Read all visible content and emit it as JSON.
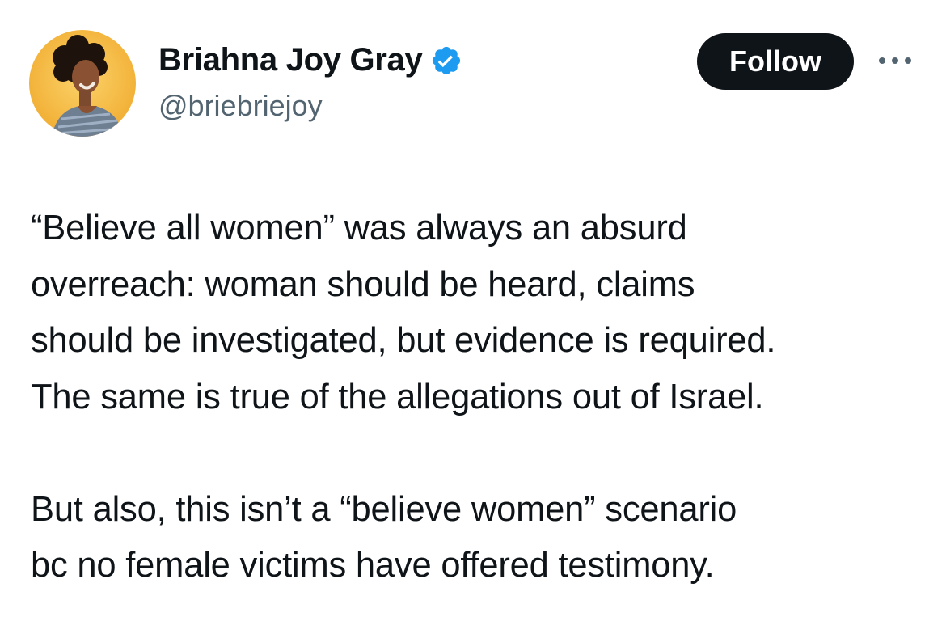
{
  "author": {
    "display_name": "Briahna Joy Gray",
    "handle": "@briebriejoy",
    "verified": true,
    "avatar_background": "#f4b63f"
  },
  "actions": {
    "follow_label": "Follow",
    "more_icon": "more-horizontal-icon"
  },
  "colors": {
    "text_primary": "#0f1419",
    "text_secondary": "#536471",
    "verified_badge": "#1d9bf0",
    "follow_button_bg": "#0f1419"
  },
  "tweet": {
    "paragraphs": [
      {
        "lines": [
          "“Believe all women” was always an absurd",
          "overreach: woman should be heard, claims",
          "should be investigated, but evidence is required.",
          "The same is true of the allegations out of Israel."
        ]
      },
      {
        "lines": [
          "But also, this isn’t a “believe women” scenario",
          "bc no female victims have offered testimony."
        ]
      }
    ]
  }
}
